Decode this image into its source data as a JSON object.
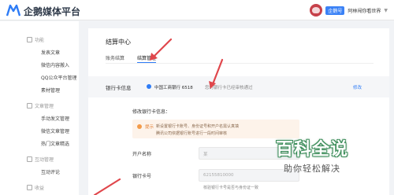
{
  "header": {
    "logo_text": "企鹅媒体平台",
    "badge": "企鹅号",
    "account_name": "阿林闯你看世界",
    "caret": "▼"
  },
  "sidebar": {
    "groups": [
      {
        "label": "功能",
        "items": [
          "发表文章",
          "微信内容搬入",
          "QQ公众平台管理",
          "素材管理"
        ]
      },
      {
        "label": "文章管理",
        "items": [
          "手动发文管理",
          "微信文章管理",
          "热门文章精选"
        ]
      },
      {
        "label": "互动管理",
        "items": [
          "互动评论"
        ]
      },
      {
        "label": "收益",
        "items": []
      }
    ]
  },
  "main": {
    "title": "结算中心",
    "tabs": [
      {
        "label": "账务结算",
        "active": false
      },
      {
        "label": "结算管理",
        "active": true
      }
    ],
    "bank": {
      "label": "银行卡信息",
      "value": "中国工商银行 6518",
      "status": "您的银行卡已经审核通过",
      "modify": "修改"
    },
    "section_title": "修改银行卡信息：",
    "tip": {
      "label": "提示",
      "line1": "新设置银行卡账号、身份证号和开户名需认真填",
      "line2": "腾讯公司依据银行账号进行一段时间审核"
    },
    "fields": [
      {
        "label": "开户名称",
        "value": "某",
        "hint": ""
      },
      {
        "label": "银行卡号",
        "value": "62155810000",
        "hint": "核验银行卡号是否与身份证一致"
      }
    ]
  },
  "watermark": {
    "title": "百科全说",
    "subtitle": "助你轻松解决"
  },
  "colors": {
    "accent": "#2e7cf6",
    "arrow": "#e0474c",
    "tip_bg": "#fdf3ea",
    "watermark_green": "#3c8d5a"
  }
}
